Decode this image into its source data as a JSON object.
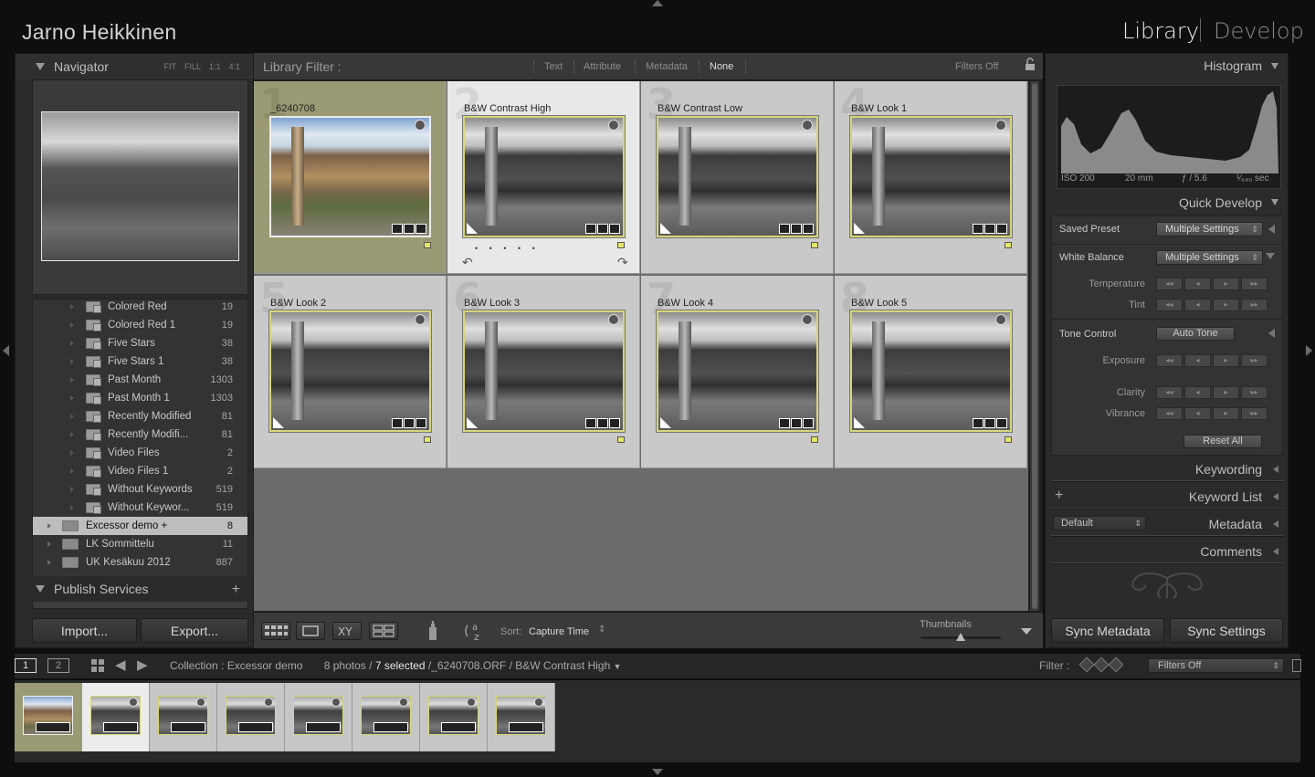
{
  "identity_plate": "Jarno Heikkinen",
  "modules": {
    "library": "Library",
    "develop": "Develop"
  },
  "navigator": {
    "title": "Navigator",
    "zoom_options": [
      "FIT",
      "FILL",
      "1:1",
      "4:1"
    ]
  },
  "collections": [
    {
      "name": "Colored Red",
      "count": "19"
    },
    {
      "name": "Colored Red 1",
      "count": "19"
    },
    {
      "name": "Five Stars",
      "count": "38"
    },
    {
      "name": "Five Stars 1",
      "count": "38"
    },
    {
      "name": "Past Month",
      "count": "1303"
    },
    {
      "name": "Past Month 1",
      "count": "1303"
    },
    {
      "name": "Recently Modified",
      "count": "81"
    },
    {
      "name": "Recently Modifi...",
      "count": "81"
    },
    {
      "name": "Video Files",
      "count": "2"
    },
    {
      "name": "Video Files 1",
      "count": "2"
    },
    {
      "name": "Without Keywords",
      "count": "519"
    },
    {
      "name": "Without Keywor...",
      "count": "519"
    }
  ],
  "collection_sets": [
    {
      "name": "Excessor demo  +",
      "count": "8",
      "selected": true
    },
    {
      "name": "LK Sommittelu",
      "count": "11"
    },
    {
      "name": "UK Kesäkuu 2012",
      "count": "887"
    }
  ],
  "publish_services": {
    "title": "Publish Services"
  },
  "buttons": {
    "import": "Import...",
    "export": "Export...",
    "sync_metadata": "Sync Metadata",
    "sync_settings": "Sync Settings"
  },
  "library_filter": {
    "label": "Library Filter :",
    "options": [
      "Text",
      "Attribute",
      "Metadata",
      "None"
    ],
    "active": "None",
    "preset": "Filters Off"
  },
  "grid_photos": [
    {
      "index": "1",
      "name": "_6240708",
      "color": true
    },
    {
      "index": "2",
      "name": "B&W Contrast High",
      "primary": true
    },
    {
      "index": "3",
      "name": "B&W Contrast Low"
    },
    {
      "index": "4",
      "name": "B&W Look 1"
    },
    {
      "index": "5",
      "name": "B&W Look 2"
    },
    {
      "index": "6",
      "name": "B&W Look 3"
    },
    {
      "index": "7",
      "name": "B&W Look 4"
    },
    {
      "index": "8",
      "name": "B&W Look 5"
    }
  ],
  "rating_dots": "• • • • •",
  "toolbar": {
    "sort_label": "Sort:",
    "sort_value": "Capture Time",
    "thumbnails_label": "Thumbnails"
  },
  "histogram": {
    "title": "Histogram",
    "iso": "ISO 200",
    "focal": "20 mm",
    "aperture": "ƒ / 5.6",
    "shutter": "¹⁄₆₄₀ sec"
  },
  "quick_develop": {
    "title": "Quick Develop",
    "saved_preset_label": "Saved Preset",
    "saved_preset_value": "Multiple Settings",
    "white_balance_label": "White Balance",
    "white_balance_value": "Multiple Settings",
    "temperature": "Temperature",
    "tint": "Tint",
    "tone_control": "Tone Control",
    "auto_tone": "Auto Tone",
    "exposure": "Exposure",
    "clarity": "Clarity",
    "vibrance": "Vibrance",
    "reset_all": "Reset All"
  },
  "panels": {
    "keywording": "Keywording",
    "keyword_list": "Keyword List",
    "metadata": "Metadata",
    "metadata_preset": "Default",
    "comments": "Comments"
  },
  "filmstrip": {
    "pages": [
      "1",
      "2"
    ],
    "collection": "Collection : Excessor demo",
    "count_text": "8 photos /",
    "selected_text": "7 selected",
    "file_text": "/_6240708.ORF / B&W Contrast High",
    "filter_label": "Filter :",
    "filter_value": "Filters Off"
  }
}
